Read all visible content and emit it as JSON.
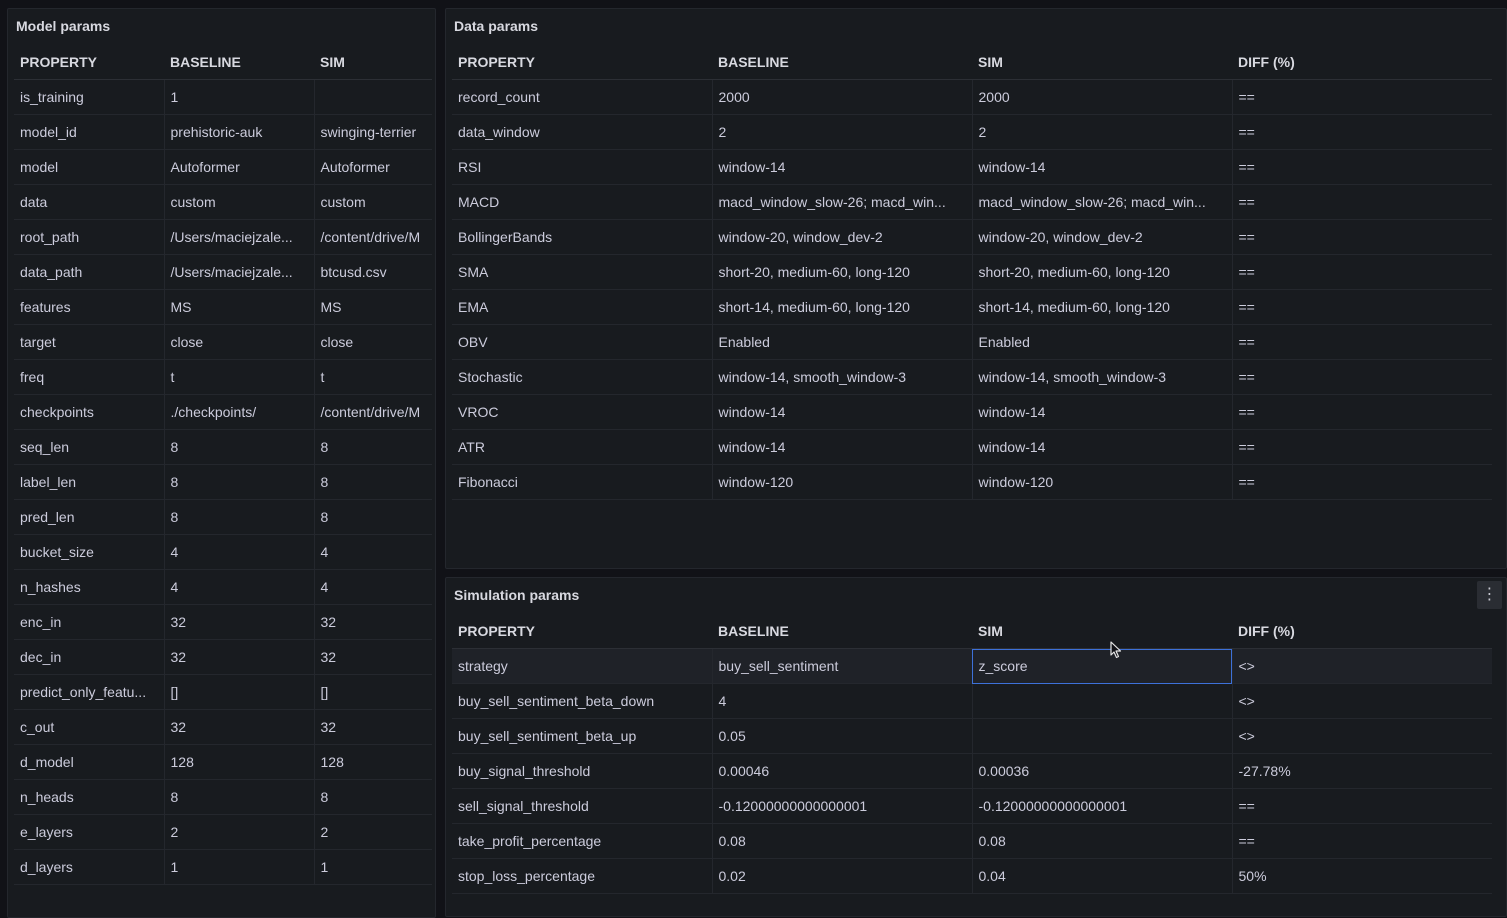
{
  "model_params": {
    "title": "Model params",
    "headers": [
      "PROPERTY",
      "BASELINE",
      "SIM"
    ],
    "rows": [
      [
        "is_training",
        "1",
        ""
      ],
      [
        "model_id",
        "prehistoric-auk",
        "swinging-terrier"
      ],
      [
        "model",
        "Autoformer",
        "Autoformer"
      ],
      [
        "data",
        "custom",
        "custom"
      ],
      [
        "root_path",
        "/Users/maciejzale...",
        "/content/drive/M"
      ],
      [
        "data_path",
        "/Users/maciejzale...",
        "btcusd.csv"
      ],
      [
        "features",
        "MS",
        "MS"
      ],
      [
        "target",
        "close",
        "close"
      ],
      [
        "freq",
        "t",
        "t"
      ],
      [
        "checkpoints",
        "./checkpoints/",
        "/content/drive/M"
      ],
      [
        "seq_len",
        "8",
        "8"
      ],
      [
        "label_len",
        "8",
        "8"
      ],
      [
        "pred_len",
        "8",
        "8"
      ],
      [
        "bucket_size",
        "4",
        "4"
      ],
      [
        "n_hashes",
        "4",
        "4"
      ],
      [
        "enc_in",
        "32",
        "32"
      ],
      [
        "dec_in",
        "32",
        "32"
      ],
      [
        "predict_only_featu...",
        "[]",
        "[]"
      ],
      [
        "c_out",
        "32",
        "32"
      ],
      [
        "d_model",
        "128",
        "128"
      ],
      [
        "n_heads",
        "8",
        "8"
      ],
      [
        "e_layers",
        "2",
        "2"
      ],
      [
        "d_layers",
        "1",
        "1"
      ]
    ]
  },
  "data_params": {
    "title": "Data params",
    "headers": [
      "PROPERTY",
      "BASELINE",
      "SIM",
      "DIFF (%)"
    ],
    "rows": [
      [
        "record_count",
        "2000",
        "2000",
        "=="
      ],
      [
        "data_window",
        "2",
        "2",
        "=="
      ],
      [
        "RSI",
        "window-14",
        "window-14",
        "=="
      ],
      [
        "MACD",
        "macd_window_slow-26; macd_win...",
        "macd_window_slow-26; macd_win...",
        "=="
      ],
      [
        "BollingerBands",
        "window-20, window_dev-2",
        "window-20, window_dev-2",
        "=="
      ],
      [
        "SMA",
        "short-20, medium-60, long-120",
        "short-20, medium-60, long-120",
        "=="
      ],
      [
        "EMA",
        "short-14, medium-60, long-120",
        "short-14, medium-60, long-120",
        "=="
      ],
      [
        "OBV",
        "Enabled",
        "Enabled",
        "=="
      ],
      [
        "Stochastic",
        "window-14, smooth_window-3",
        "window-14, smooth_window-3",
        "=="
      ],
      [
        "VROC",
        "window-14",
        "window-14",
        "=="
      ],
      [
        "ATR",
        "window-14",
        "window-14",
        "=="
      ],
      [
        "Fibonacci",
        "window-120",
        "window-120",
        "=="
      ]
    ]
  },
  "simulation_params": {
    "title": "Simulation params",
    "menu_icon": "kebab-menu-icon",
    "headers": [
      "PROPERTY",
      "BASELINE",
      "SIM",
      "DIFF (%)"
    ],
    "rows": [
      [
        "strategy",
        "buy_sell_sentiment",
        "z_score",
        "<>"
      ],
      [
        "buy_sell_sentiment_beta_down",
        "4",
        "",
        "<>"
      ],
      [
        "buy_sell_sentiment_beta_up",
        "0.05",
        "",
        "<>"
      ],
      [
        "buy_signal_threshold",
        "0.00046",
        "0.00036",
        "-27.78%"
      ],
      [
        "sell_signal_threshold",
        "-0.12000000000000001",
        "-0.12000000000000001",
        "=="
      ],
      [
        "take_profit_percentage",
        "0.08",
        "0.08",
        "=="
      ],
      [
        "stop_loss_percentage",
        "0.02",
        "0.04",
        "50%"
      ]
    ]
  }
}
